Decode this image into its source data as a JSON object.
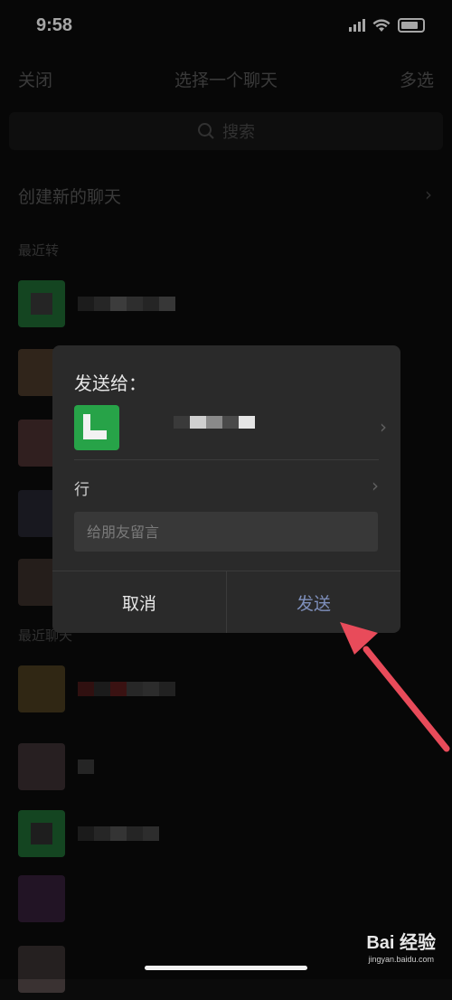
{
  "status_bar": {
    "time": "9:58"
  },
  "nav": {
    "close_label": "关闭",
    "title": "选择一个聊天",
    "multiselect_label": "多选"
  },
  "search": {
    "placeholder": "搜索"
  },
  "list": {
    "new_chat_label": "创建新的聊天",
    "section_recent_forward": "最近转",
    "section_recent_chats": "最近聊天"
  },
  "dialog": {
    "title": "发送给：",
    "message_preview": "行",
    "note_placeholder": "给朋友留言",
    "cancel_label": "取消",
    "send_label": "发送"
  },
  "watermark": {
    "brand": "Bai 经验",
    "url": "jingyan.baidu.com"
  },
  "colors": {
    "accent_green": "#27a348",
    "send_blue": "#7e8fbb",
    "arrow_red": "#e84b5a"
  },
  "icons": [
    "search-icon",
    "chevron-right-icon",
    "signal-icon",
    "wifi-icon",
    "battery-icon"
  ]
}
